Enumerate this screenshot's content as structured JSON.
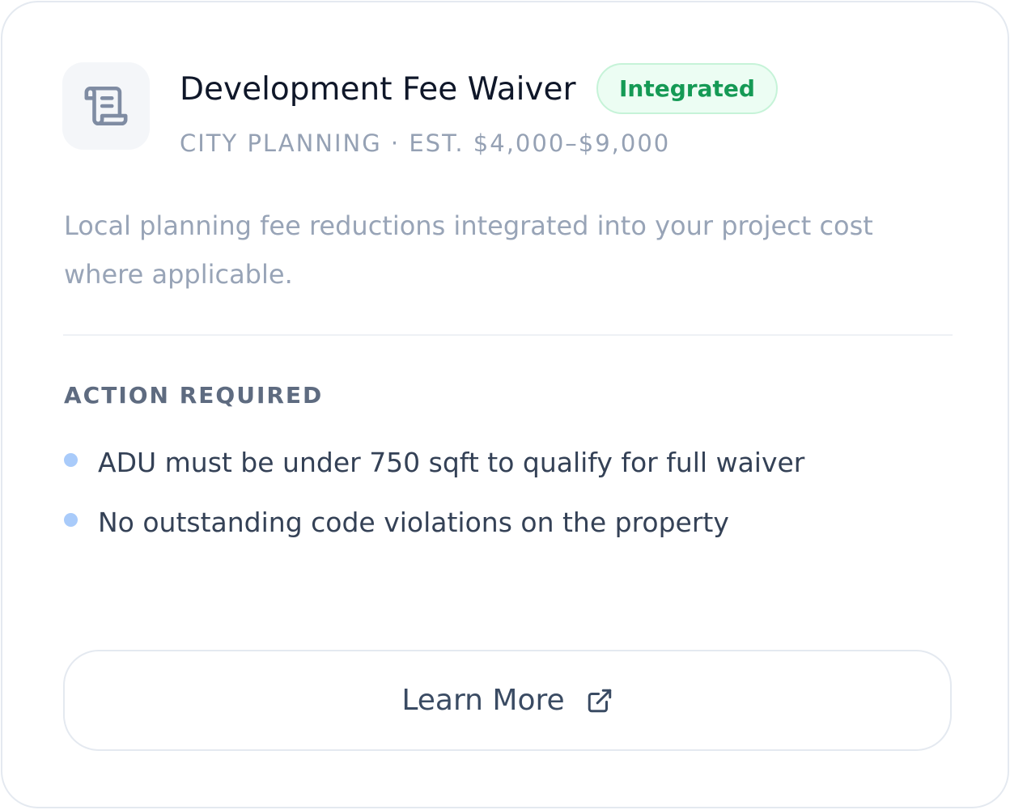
{
  "card": {
    "icon": "scroll-icon",
    "title": "Development Fee Waiver",
    "badge": "Integrated",
    "subtitle": "CITY PLANNING · EST. $4,000–$9,000",
    "description": "Local planning fee reductions integrated into your project cost where applicable."
  },
  "requirements": {
    "heading": "ACTION REQUIRED",
    "items": [
      "ADU must be under 750 sqft to qualify for full waiver",
      "No outstanding code violations on the property"
    ]
  },
  "action": {
    "label": "Learn More",
    "icon": "external-link-icon"
  },
  "colors": {
    "title": "#0f1729",
    "badge_text": "#159a55",
    "badge_bg": "#ecfdf3",
    "bullet": "#a9cbfa",
    "muted": "#95a1b4"
  }
}
